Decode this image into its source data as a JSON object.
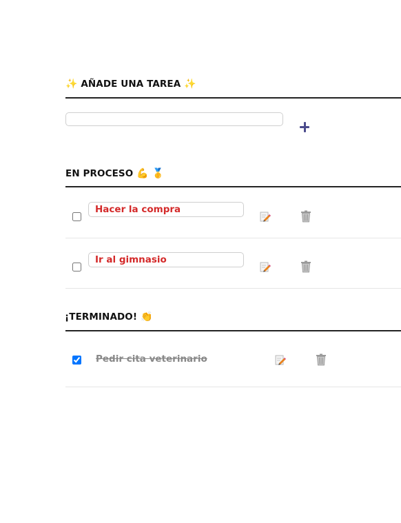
{
  "add_section": {
    "title_prefix": "✨",
    "title": "AÑADE UNA TAREA",
    "title_suffix": "✨",
    "input_value": "",
    "add_button_label": "+"
  },
  "in_progress": {
    "title": "EN PROCESO",
    "title_emojis": "💪 🥇",
    "tasks": [
      {
        "text": "Hacer la compra",
        "done": false
      },
      {
        "text": "Ir al gimnasio",
        "done": false
      }
    ]
  },
  "finished": {
    "title": "¡TERMINADO!",
    "title_emoji": "👏",
    "tasks": [
      {
        "text": "Pedir cita veterinario",
        "done": true
      }
    ]
  },
  "icons": {
    "edit": "edit-pencil-icon",
    "delete": "trash-icon",
    "add": "plus-icon"
  },
  "colors": {
    "task_text": "#d42a2a",
    "done_text": "#888888",
    "add_button": "#4b4b8c",
    "rule": "#222222"
  }
}
